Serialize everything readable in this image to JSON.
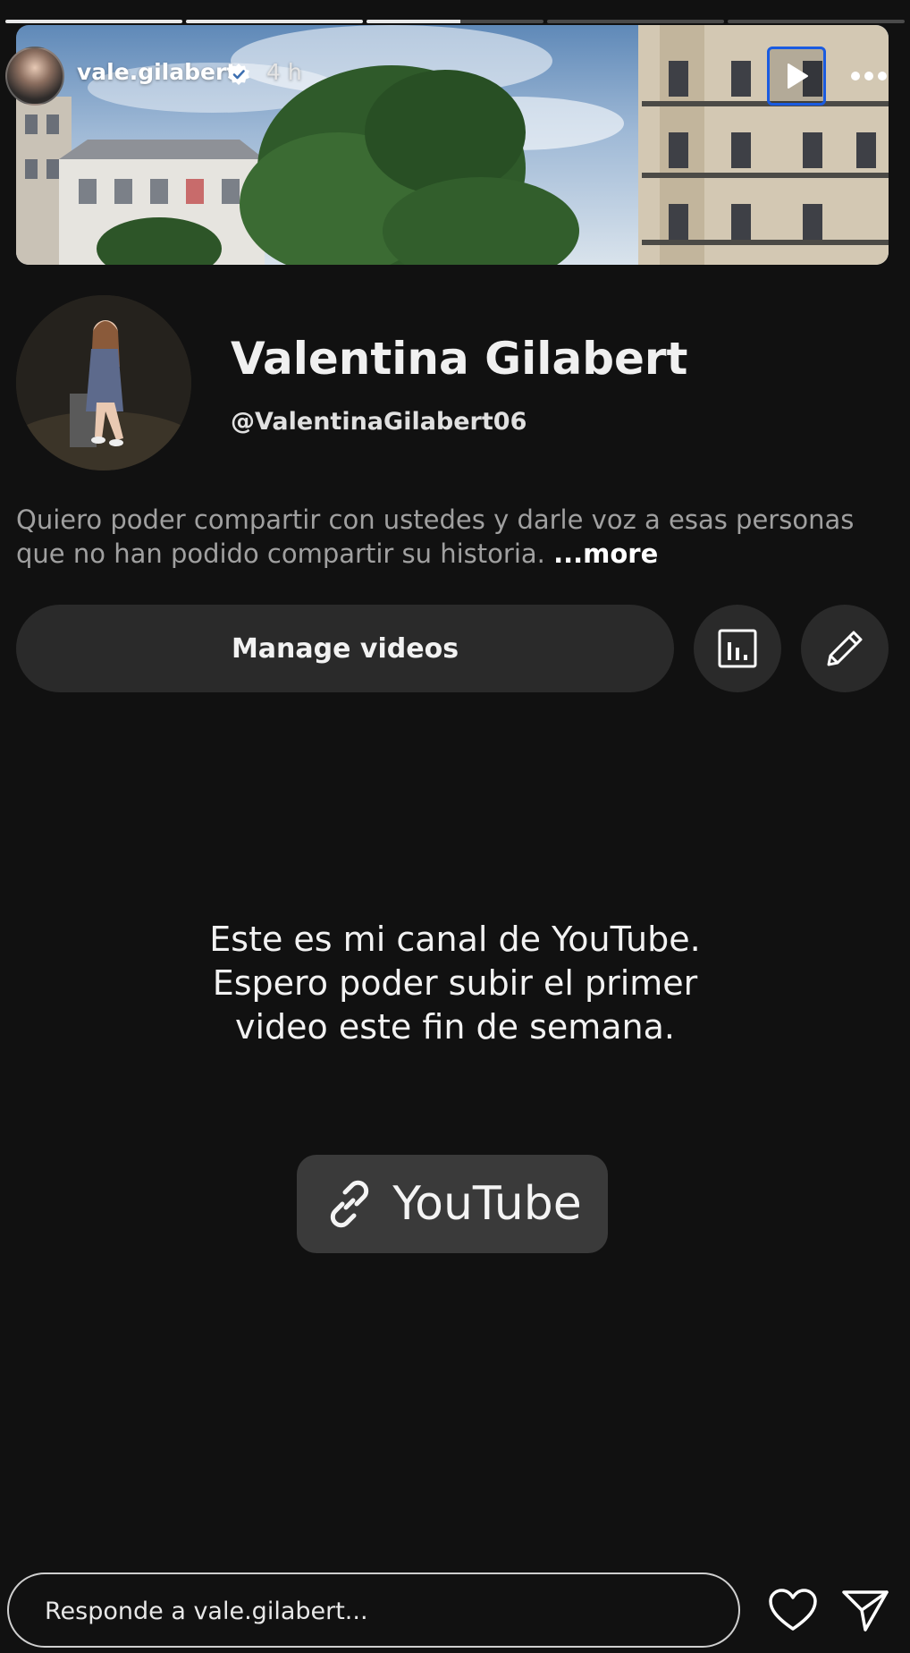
{
  "story": {
    "progress": [
      1,
      1,
      0.53,
      0,
      0
    ],
    "username": "vale.gilabert",
    "time": "4 h",
    "icons": {
      "verified": "verified-badge-icon",
      "play": "play-icon",
      "more": "more-dots-icon"
    }
  },
  "profile": {
    "name": "Valentina Gilabert",
    "handle": "@ValentinaGilabert06",
    "bio": "Quiero poder compartir con ustedes y darle voz a esas personas que no han podido compartir su historia.",
    "bio_more": "...more"
  },
  "actions": {
    "manage_label": "Manage videos",
    "stats_icon": "bar-chart-icon",
    "edit_icon": "pencil-icon"
  },
  "caption": {
    "lines": [
      "Este es mi canal de YouTube.",
      "Espero poder subir el primer",
      "video este fin de semana."
    ]
  },
  "link_sticker": {
    "label": "YouTube",
    "icon": "link-icon"
  },
  "reply": {
    "placeholder": "Responde a vale.gilabert...",
    "icons": {
      "like": "heart-icon",
      "send": "send-icon"
    }
  },
  "colors": {
    "background": "#111111",
    "button": "#2a2a2a",
    "accent_border": "#1a5be0",
    "sticker": "#3a3a3a"
  }
}
